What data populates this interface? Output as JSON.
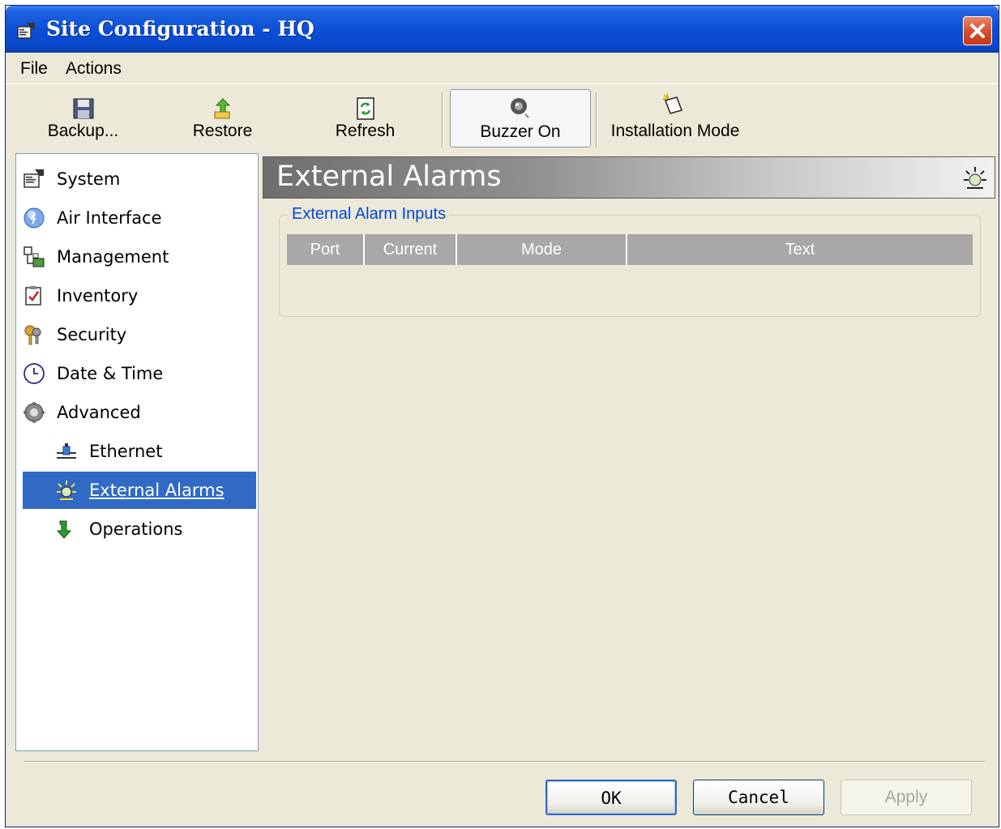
{
  "window": {
    "title": "Site Configuration - HQ",
    "title_bar_color": "#0b4fd6"
  },
  "menu": {
    "items": [
      "File",
      "Actions"
    ]
  },
  "toolbar": {
    "buttons": [
      {
        "label": "Backup...",
        "icon": "floppy-disk-icon"
      },
      {
        "label": "Restore",
        "icon": "restore-arrow-icon"
      },
      {
        "label": "Refresh",
        "icon": "refresh-icon"
      },
      {
        "label": "Buzzer On",
        "icon": "buzzer-icon",
        "pressed": true
      },
      {
        "label": "Installation Mode",
        "icon": "installation-mode-icon"
      }
    ]
  },
  "nav": {
    "items": [
      {
        "label": "System",
        "icon": "system-icon"
      },
      {
        "label": "Air Interface",
        "icon": "air-interface-icon"
      },
      {
        "label": "Management",
        "icon": "management-icon"
      },
      {
        "label": "Inventory",
        "icon": "inventory-icon"
      },
      {
        "label": "Security",
        "icon": "security-keys-icon"
      },
      {
        "label": "Date & Time",
        "icon": "clock-icon"
      },
      {
        "label": "Advanced",
        "icon": "gear-icon"
      },
      {
        "label": "Ethernet",
        "icon": "ethernet-icon"
      },
      {
        "label": "External Alarms",
        "icon": "alarm-icon",
        "selected": true
      },
      {
        "label": "Operations",
        "icon": "down-arrow-icon"
      }
    ],
    "selected_color": "#316ac5"
  },
  "panel": {
    "title": "External Alarms",
    "group_title": "External Alarm Inputs",
    "columns": [
      "Port",
      "Current",
      "Mode",
      "Text"
    ],
    "rows": []
  },
  "dialog_buttons": {
    "ok": "OK",
    "cancel": "Cancel",
    "apply": "Apply"
  }
}
